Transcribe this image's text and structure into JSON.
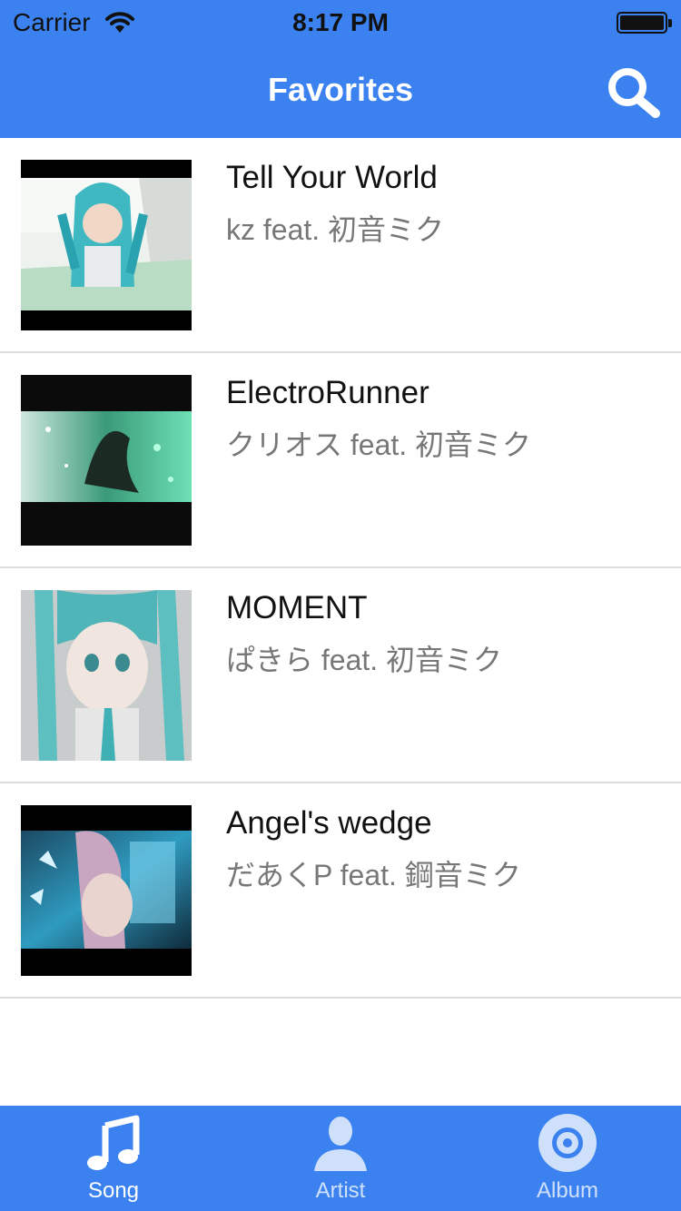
{
  "status_bar": {
    "carrier": "Carrier",
    "time": "8:17 PM"
  },
  "nav": {
    "title": "Favorites",
    "search_icon": "search-icon"
  },
  "songs": [
    {
      "title": "Tell Your World",
      "artist": "kz feat. 初音ミク"
    },
    {
      "title": "ElectroRunner",
      "artist": "クリオス feat. 初音ミク"
    },
    {
      "title": "MOMENT",
      "artist": "ぱきら feat. 初音ミク"
    },
    {
      "title": "Angel's wedge",
      "artist": "だあくP feat. 鋼音ミク"
    }
  ],
  "tabs": [
    {
      "label": "Song",
      "icon": "music-note-icon",
      "active": true
    },
    {
      "label": "Artist",
      "icon": "person-icon",
      "active": false
    },
    {
      "label": "Album",
      "icon": "disc-icon",
      "active": false
    }
  ],
  "colors": {
    "accent": "#3b82f0",
    "tab_active": "#ffffff",
    "tab_inactive": "#cfe0fb"
  }
}
